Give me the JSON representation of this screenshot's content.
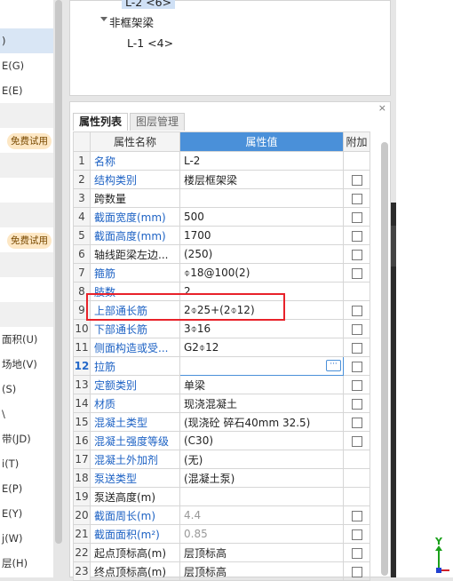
{
  "left_panel": {
    "items": [
      {
        "label": ")",
        "state": "selected"
      },
      {
        "label": "E(G)",
        "state": "normal"
      },
      {
        "label": "E(E)",
        "state": "normal"
      },
      {
        "label": "",
        "state": "alt"
      },
      {
        "label": "",
        "state": "badge",
        "badge": "免费试用"
      },
      {
        "label": "",
        "state": "alt"
      },
      {
        "label": "",
        "state": "normal"
      },
      {
        "label": "",
        "state": "alt"
      },
      {
        "label": "",
        "state": "badge",
        "badge": "免费试用"
      },
      {
        "label": "",
        "state": "alt"
      },
      {
        "label": "",
        "state": "normal"
      },
      {
        "label": "",
        "state": "alt"
      },
      {
        "label": "面积(U)",
        "state": "normal"
      },
      {
        "label": "场地(V)",
        "state": "normal"
      },
      {
        "label": "(S)",
        "state": "normal"
      },
      {
        "label": "\\",
        "state": "normal"
      },
      {
        "label": "带(JD)",
        "state": "normal"
      },
      {
        "label": "i(T)",
        "state": "normal"
      },
      {
        "label": "E(P)",
        "state": "normal"
      },
      {
        "label": "E(Y)",
        "state": "normal"
      },
      {
        "label": "j(W)",
        "state": "normal"
      },
      {
        "label": "层(H)",
        "state": "normal"
      },
      {
        "label": "E(K)",
        "state": "normal"
      }
    ]
  },
  "tree": {
    "top_node": "L-2 <6>",
    "group_label": "非框架梁",
    "child_node": "L-1 <4>"
  },
  "panel": {
    "close_glyph": "×",
    "tabs": [
      "属性列表",
      "图层管理"
    ]
  },
  "grid": {
    "headers": {
      "num": "",
      "name": "属性名称",
      "value": "属性值",
      "extra": "附加"
    },
    "current_row": 12,
    "rows": [
      {
        "n": "1",
        "name": "名称",
        "value": "L-2",
        "name_color": "blue",
        "value_color": "normal",
        "check": false
      },
      {
        "n": "2",
        "name": "结构类别",
        "value": "楼层框架梁",
        "name_color": "blue",
        "value_color": "normal",
        "check": true
      },
      {
        "n": "3",
        "name": "跨数量",
        "value": "",
        "name_color": "dark",
        "value_color": "normal",
        "check": true
      },
      {
        "n": "4",
        "name": "截面宽度(mm)",
        "value": "500",
        "name_color": "blue",
        "value_color": "normal",
        "check": true
      },
      {
        "n": "5",
        "name": "截面高度(mm)",
        "value": "1700",
        "name_color": "blue",
        "value_color": "normal",
        "check": true
      },
      {
        "n": "6",
        "name": "轴线距梁左边...",
        "value": "(250)",
        "name_color": "dark",
        "value_color": "normal",
        "check": true
      },
      {
        "n": "7",
        "name": "箍筋",
        "value": "⌽18@100(2)",
        "name_color": "blue",
        "value_color": "normal",
        "check": true
      },
      {
        "n": "8",
        "name": "肢数",
        "value": "2",
        "name_color": "blue",
        "value_color": "normal",
        "check": false
      },
      {
        "n": "9",
        "name": "上部通长筋",
        "value": "2⌽25+(2⌽12)",
        "name_color": "blue",
        "value_color": "normal",
        "check": true
      },
      {
        "n": "10",
        "name": "下部通长筋",
        "value": "3⌽16",
        "name_color": "blue",
        "value_color": "normal",
        "check": true
      },
      {
        "n": "11",
        "name": "侧面构造或受...",
        "value": "G2⌽12",
        "name_color": "blue",
        "value_color": "normal",
        "check": true
      },
      {
        "n": "12",
        "name": "拉筋",
        "value": "",
        "name_color": "blue",
        "value_color": "normal",
        "check": true
      },
      {
        "n": "13",
        "name": "定额类别",
        "value": "单梁",
        "name_color": "blue",
        "value_color": "normal",
        "check": true
      },
      {
        "n": "14",
        "name": "材质",
        "value": "现浇混凝土",
        "name_color": "blue",
        "value_color": "normal",
        "check": true
      },
      {
        "n": "15",
        "name": "混凝土类型",
        "value": "(现浇砼 碎石40mm 32.5)",
        "name_color": "blue",
        "value_color": "normal",
        "check": true
      },
      {
        "n": "16",
        "name": "混凝土强度等级",
        "value": "(C30)",
        "name_color": "blue",
        "value_color": "normal",
        "check": true
      },
      {
        "n": "17",
        "name": "混凝土外加剂",
        "value": "(无)",
        "name_color": "blue",
        "value_color": "normal",
        "check": false
      },
      {
        "n": "18",
        "name": "泵送类型",
        "value": "(混凝土泵)",
        "name_color": "blue",
        "value_color": "normal",
        "check": false
      },
      {
        "n": "19",
        "name": "泵送高度(m)",
        "value": "",
        "name_color": "dark",
        "value_color": "normal",
        "check": false
      },
      {
        "n": "20",
        "name": "截面周长(m)",
        "value": "4.4",
        "name_color": "blue",
        "value_color": "gray",
        "check": true
      },
      {
        "n": "21",
        "name": "截面面积(m²)",
        "value": "0.85",
        "name_color": "blue",
        "value_color": "gray",
        "check": true
      },
      {
        "n": "22",
        "name": "起点顶标高(m)",
        "value": "层顶标高",
        "name_color": "dark",
        "value_color": "normal",
        "check": true
      },
      {
        "n": "23",
        "name": "终点顶标高(m)",
        "value": "层顶标高",
        "name_color": "dark",
        "value_color": "normal",
        "check": true
      }
    ]
  },
  "colors": {
    "header_accent": "#4a90d9",
    "highlight_box": "#e8222a",
    "blue_label": "#1d62c4"
  },
  "axis": {
    "y_label": "Y"
  }
}
